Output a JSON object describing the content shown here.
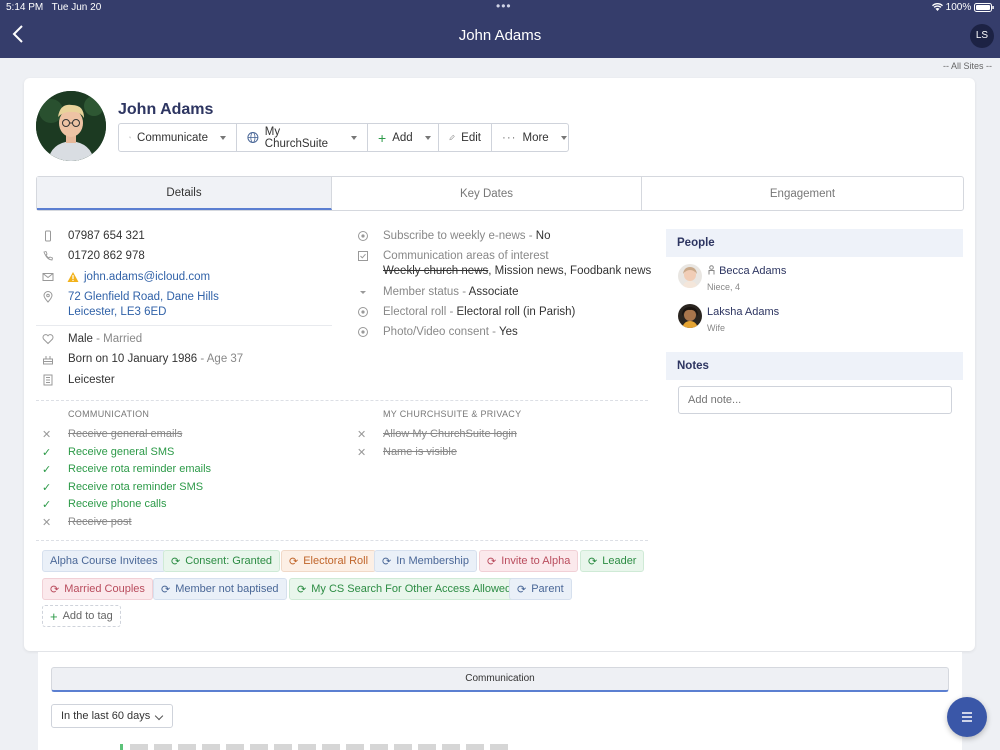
{
  "statusbar": {
    "time": "5:14 PM",
    "date": "Tue Jun 20",
    "battery": "100%"
  },
  "nav": {
    "title": "John Adams",
    "user_initials": "LS"
  },
  "site_filter": "-- All Sites --",
  "person": {
    "name": "John Adams"
  },
  "actions": {
    "communicate": "Communicate",
    "churchsuite": "My ChurchSuite",
    "add": "Add",
    "edit": "Edit",
    "more": "More"
  },
  "tabs": [
    {
      "label": "Details",
      "active": true
    },
    {
      "label": "Key Dates",
      "active": false
    },
    {
      "label": "Engagement",
      "active": false
    }
  ],
  "contact": {
    "mobile": "07987 654 321",
    "phone": "01720 862 978",
    "email": "john.adams@icloud.com",
    "address_line1": "72 Glenfield Road, Dane Hills",
    "address_line2": "Leicester, LE3 6ED"
  },
  "personal": {
    "sex": "Male",
    "marital": "Married",
    "born": "Born on 10 January 1986",
    "age": "Age 37",
    "site": "Leicester"
  },
  "fields": {
    "subscribe_label": "Subscribe to weekly e-news",
    "subscribe_value": "No",
    "comm_areas_label": "Communication areas of interest",
    "comm_area_struck": "Weekly church news",
    "comm_areas_rest": ", Mission news, Foodbank news",
    "member_status_label": "Member status",
    "member_status_value": "Associate",
    "electoral_label": "Electoral roll",
    "electoral_value": "Electoral roll (in Parish)",
    "photo_label": "Photo/Video consent",
    "photo_value": "Yes",
    "separator": " - "
  },
  "communication": {
    "heading": "COMMUNICATION",
    "items": [
      {
        "label": "Receive general emails",
        "enabled": false
      },
      {
        "label": "Receive general SMS",
        "enabled": true
      },
      {
        "label": "Receive rota reminder emails",
        "enabled": true
      },
      {
        "label": "Receive rota reminder SMS",
        "enabled": true
      },
      {
        "label": "Receive phone calls",
        "enabled": true
      },
      {
        "label": "Receive post",
        "enabled": false
      }
    ]
  },
  "privacy": {
    "heading": "MY CHURCHSUITE & PRIVACY",
    "items": [
      {
        "label": "Allow My ChurchSuite login",
        "enabled": false
      },
      {
        "label": "Name is visible",
        "enabled": false
      }
    ]
  },
  "tags": [
    {
      "label": "Alpha Course Invitees",
      "color": "blue",
      "smart": false
    },
    {
      "label": "Consent: Granted",
      "color": "green",
      "smart": true
    },
    {
      "label": "Electoral Roll",
      "color": "orange",
      "smart": true
    },
    {
      "label": "In Membership",
      "color": "blue",
      "smart": true
    },
    {
      "label": "Invite to Alpha",
      "color": "pink",
      "smart": true
    },
    {
      "label": "Leader",
      "color": "green",
      "smart": true
    },
    {
      "label": "Married Couples",
      "color": "pink",
      "smart": true
    },
    {
      "label": "Member not baptised",
      "color": "blue",
      "smart": true
    },
    {
      "label": "My CS Search For Other Access Allowed",
      "color": "green",
      "smart": true
    },
    {
      "label": "Parent",
      "color": "blue",
      "smart": true
    }
  ],
  "add_tag": "Add to tag",
  "people": {
    "heading": "People",
    "items": [
      {
        "name": "Becca Adams",
        "relation": "Niece, 4"
      },
      {
        "name": "Laksha Adams",
        "relation": "Wife"
      }
    ]
  },
  "notes": {
    "heading": "Notes",
    "placeholder": "Add note..."
  },
  "lower": {
    "tab": "Communication",
    "period": "In the last 60 days"
  },
  "colors": {
    "nav": "#353d6b",
    "accent": "#5b7fd1",
    "green": "#2c9a48",
    "fab": "#3a57a8"
  }
}
